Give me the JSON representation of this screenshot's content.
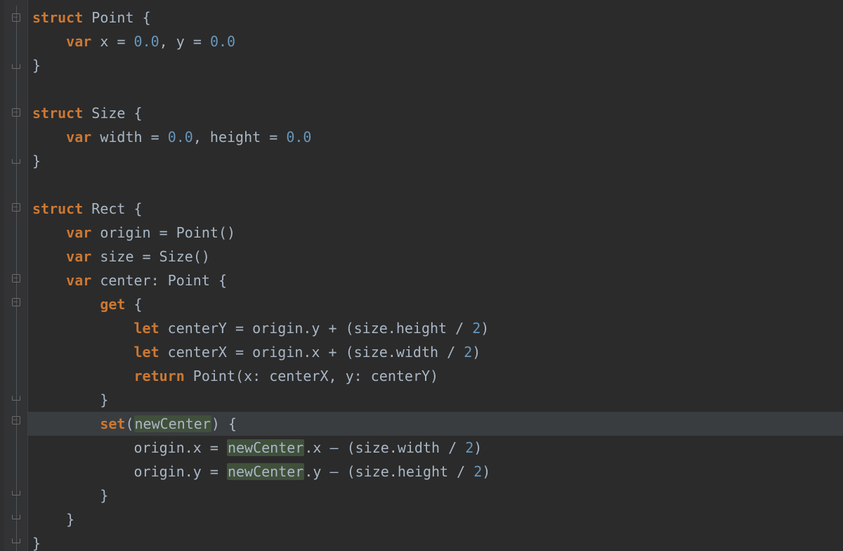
{
  "code": {
    "l1": {
      "kw": "struct",
      "type": "Point",
      "brace": "{"
    },
    "l2": {
      "kw": "var",
      "n1": "x",
      "eq1": "=",
      "v1": "0.0",
      "comma": ",",
      "n2": "y",
      "eq2": "=",
      "v2": "0.0"
    },
    "l3": {
      "brace": "}"
    },
    "l4": {
      "blank": ""
    },
    "l5": {
      "kw": "struct",
      "type": "Size",
      "brace": "{"
    },
    "l6": {
      "kw": "var",
      "n1": "width",
      "eq1": "=",
      "v1": "0.0",
      "comma": ",",
      "n2": "height",
      "eq2": "=",
      "v2": "0.0"
    },
    "l7": {
      "brace": "}"
    },
    "l8": {
      "blank": ""
    },
    "l9": {
      "kw": "struct",
      "type": "Rect",
      "brace": "{"
    },
    "l10": {
      "kw": "var",
      "name": "origin",
      "eq": "=",
      "call": "Point()"
    },
    "l11": {
      "kw": "var",
      "name": "size",
      "eq": "=",
      "call": "Size()"
    },
    "l12": {
      "kw": "var",
      "name": "center",
      "colon": ":",
      "type": "Point",
      "brace": "{"
    },
    "l13": {
      "kw": "get",
      "brace": "{"
    },
    "l14": {
      "kw": "let",
      "name": "centerY",
      "eq": "=",
      "rhs_a": "origin.y",
      "plus": "+",
      "open": "(",
      "rhs_b": "size.height",
      "div": "/",
      "two": "2",
      "close": ")"
    },
    "l15": {
      "kw": "let",
      "name": "centerX",
      "eq": "=",
      "rhs_a": "origin.x",
      "plus": "+",
      "open": "(",
      "rhs_b": "size.width",
      "div": "/",
      "two": "2",
      "close": ")"
    },
    "l16": {
      "kw": "return",
      "call": "Point",
      "open": "(",
      "a1": "x:",
      "v1": "centerX",
      "comma": ",",
      "a2": "y:",
      "v2": "centerY",
      "close": ")"
    },
    "l17": {
      "brace": "}"
    },
    "l18": {
      "kw": "set",
      "open": "(",
      "param": "newCenter",
      "close": ")",
      "brace": "{"
    },
    "l19": {
      "lhs": "origin.x",
      "eq": "=",
      "p": "newCenter",
      "dot": ".x",
      "minus": "–",
      "open": "(",
      "rhs": "size.width",
      "div": "/",
      "two": "2",
      "close": ")"
    },
    "l20": {
      "lhs": "origin.y",
      "eq": "=",
      "p": "newCenter",
      "dot": ".y",
      "minus": "–",
      "open": "(",
      "rhs": "size.height",
      "div": "/",
      "two": "2",
      "close": ")"
    },
    "l21": {
      "brace": "}"
    },
    "l22": {
      "brace": "}"
    },
    "l23": {
      "brace": "}"
    }
  }
}
